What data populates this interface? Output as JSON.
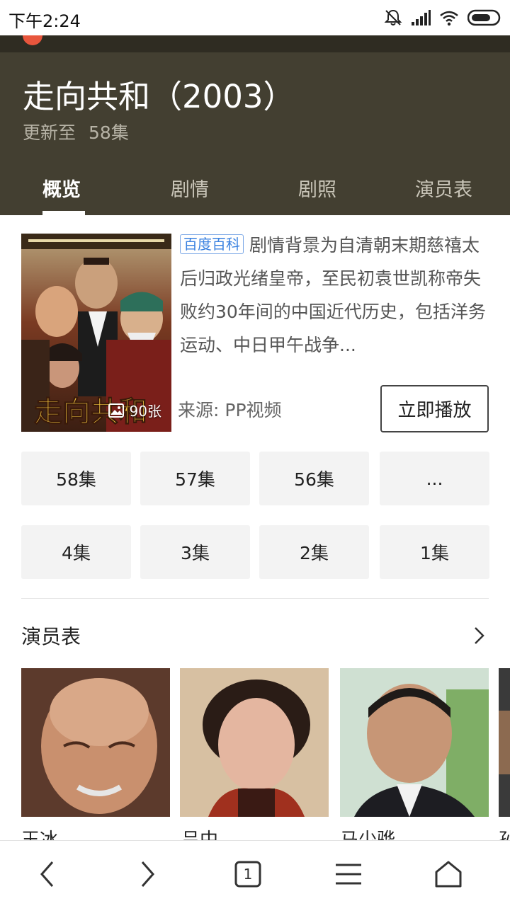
{
  "status_bar": {
    "time": "下午2:24"
  },
  "header": {
    "title": "走向共和（2003）",
    "update_label": "更新至",
    "update_value": "58集",
    "tabs": [
      {
        "label": "概览",
        "active": true
      },
      {
        "label": "剧情",
        "active": false
      },
      {
        "label": "剧照",
        "active": false
      },
      {
        "label": "演员表",
        "active": false
      }
    ]
  },
  "overview": {
    "poster_count": "90张",
    "source_tag": "百度百科",
    "description": "剧情背景为自清朝末期慈禧太后归政光绪皇帝，至民初袁世凯称帝失败约30年间的中国近代历史，包括洋务运动、中日甲午战争...",
    "source_label": "来源:",
    "source_value": "PP视频",
    "play_button": "立即播放"
  },
  "episodes": [
    "58集",
    "57集",
    "56集",
    "...",
    "4集",
    "3集",
    "2集",
    "1集"
  ],
  "cast": {
    "title": "演员表",
    "members": [
      {
        "name": "王冰"
      },
      {
        "name": "吕中"
      },
      {
        "name": "马少骅"
      },
      {
        "name": "孙"
      }
    ]
  },
  "bottom_nav": {
    "tab_count": "1"
  },
  "colors": {
    "header_bg": "#433f31",
    "accent_blue": "#3b82e0",
    "episode_bg": "#f3f3f3"
  }
}
